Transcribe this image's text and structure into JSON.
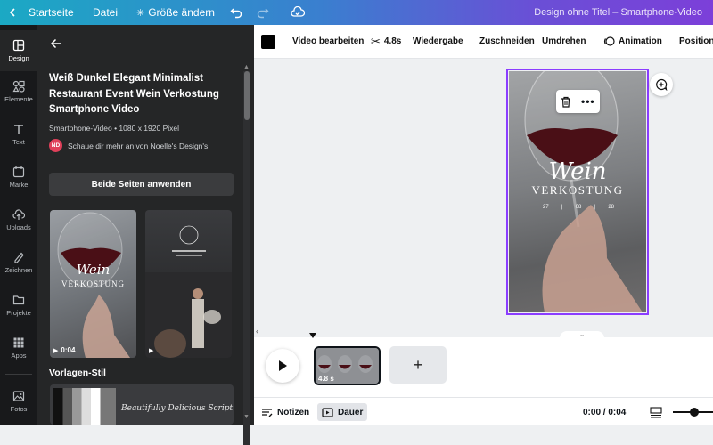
{
  "topbar": {
    "home": "Startseite",
    "file": "Datei",
    "resize": "Größe ändern",
    "doc_title": "Design ohne Titel – Smartphone-Video"
  },
  "rail": [
    {
      "label": "Design",
      "icon": "design-icon"
    },
    {
      "label": "Elemente",
      "icon": "elements-icon"
    },
    {
      "label": "Text",
      "icon": "text-icon"
    },
    {
      "label": "Marke",
      "icon": "brand-icon"
    },
    {
      "label": "Uploads",
      "icon": "upload-cloud-icon"
    },
    {
      "label": "Zeichnen",
      "icon": "pen-icon"
    },
    {
      "label": "Projekte",
      "icon": "folder-icon"
    },
    {
      "label": "Apps",
      "icon": "apps-grid-icon"
    },
    {
      "label": "Fotos",
      "icon": "photo-icon"
    }
  ],
  "panel": {
    "title": "Weiß Dunkel Elegant Minimalist Restaurant Event Wein Verkostung Smartphone Video",
    "meta": "Smartphone-Video • 1080 x 1920 Pixel",
    "author_initials": "ND",
    "author_link": "Schaue dir mehr an von Noelle's Design's.",
    "apply_button": "Beide Seiten anwenden",
    "thumb1_duration": "0:04",
    "thumb1_script": "Wein",
    "thumb1_caption": "VERKOSTUNG",
    "section_style": "Vorlagen-Stil",
    "swatch_script": "Beautifully Delicious Script"
  },
  "context_toolbar": {
    "edit_video": "Video bearbeiten",
    "duration": "4.8s",
    "playback": "Wiedergabe",
    "crop": "Zuschneiden",
    "flip": "Umdrehen",
    "animation": "Animation",
    "position": "Position",
    "color_swatch": "#000000"
  },
  "canvas": {
    "script_text": "Wein",
    "headline": "VERKOSTUNG",
    "date_parts": [
      "27",
      "08",
      "28"
    ]
  },
  "timeline": {
    "clip_label": "4.8 s"
  },
  "bottombar": {
    "notes": "Notizen",
    "duration": "Dauer",
    "time": "0:00 / 0:04"
  },
  "colors": {
    "accent": "#8b3dff",
    "panel_bg": "#252627",
    "rail_bg": "#18191b"
  }
}
